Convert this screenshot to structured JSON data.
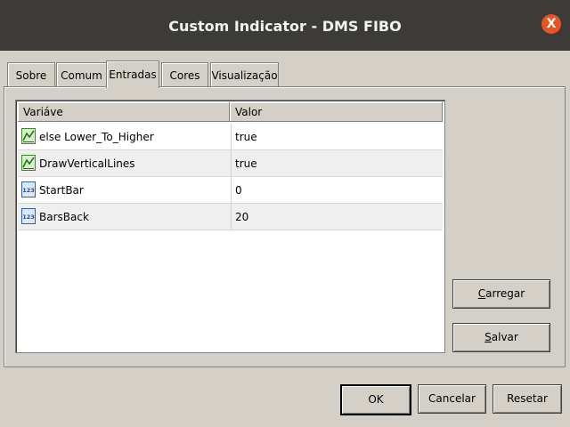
{
  "window": {
    "title": "Custom Indicator - DMS FIBO",
    "close_label": "X"
  },
  "tabs": [
    {
      "label": "Sobre",
      "active": false
    },
    {
      "label": "Comum",
      "active": false
    },
    {
      "label": "Entradas",
      "active": true
    },
    {
      "label": "Cores",
      "active": false
    },
    {
      "label": "Visualização",
      "active": false
    }
  ],
  "table": {
    "headers": [
      "Variáve",
      "Valor"
    ],
    "rows": [
      {
        "icon": "trend-line-icon",
        "name": "else Lower_To_Higher",
        "value": "true"
      },
      {
        "icon": "trend-line-icon",
        "name": "DrawVerticalLines",
        "value": "true"
      },
      {
        "icon": "numeric-123-icon",
        "name": "StartBar",
        "value": "0"
      },
      {
        "icon": "numeric-123-icon",
        "name": "BarsBack",
        "value": "20"
      }
    ]
  },
  "side_buttons": {
    "load_first": "C",
    "load_rest": "arregar",
    "save_first": "S",
    "save_rest": "alvar"
  },
  "footer_buttons": {
    "ok": "OK",
    "cancel": "Cancelar",
    "reset": "Resetar"
  },
  "colors": {
    "titlebar": "#3c3b37",
    "close": "#e95420",
    "dialog": "#d4d0c8"
  }
}
